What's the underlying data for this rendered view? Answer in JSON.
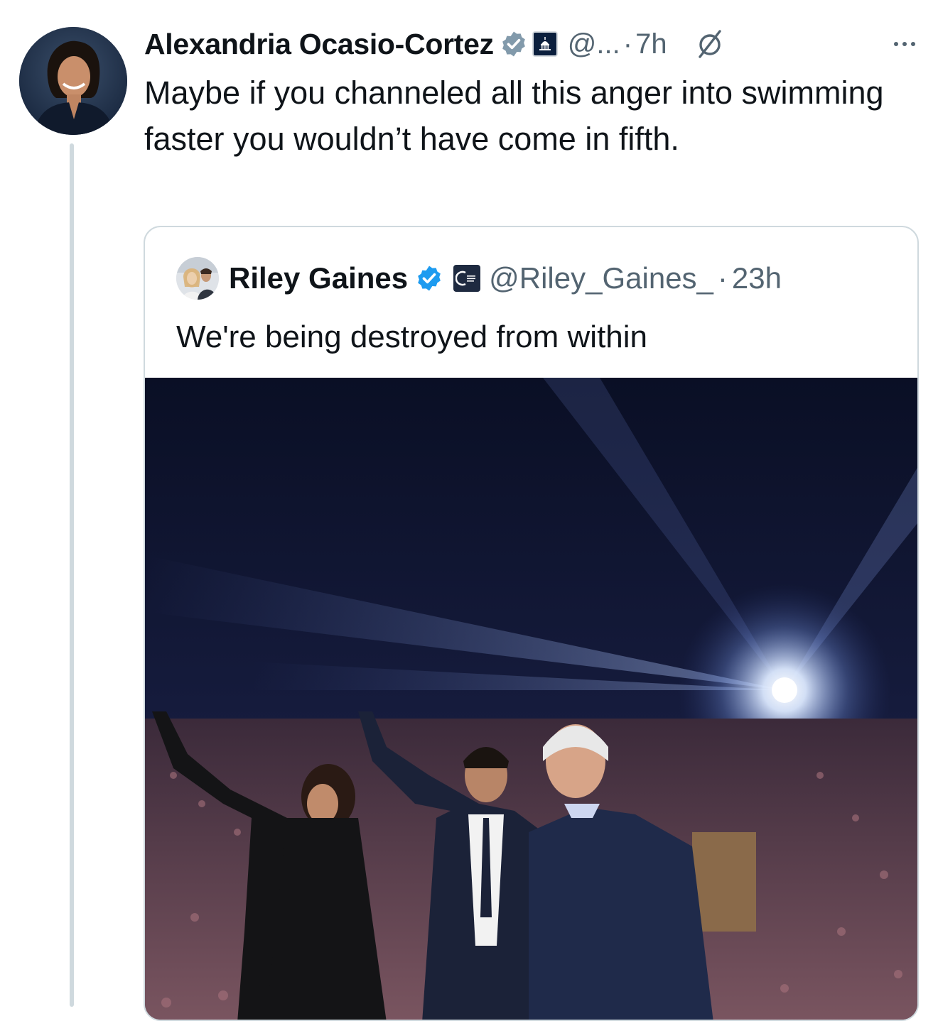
{
  "tweet": {
    "author": {
      "display_name": "Alexandria Ocasio-Cortez",
      "handle": "@...",
      "verified_badge": "gray-check",
      "affiliation_badge": "capitol-icon"
    },
    "separator": "·",
    "time": "7h",
    "text": "Maybe if you channeled all this anger into swimming faster you wouldn’t have come in fifth.",
    "icons": [
      "grok-icon",
      "more-icon"
    ]
  },
  "quote": {
    "author": {
      "display_name": "Riley Gaines",
      "handle": "@Riley_Gaines_",
      "verified_badge": "blue-check",
      "affiliation_badge": "turning-point-icon"
    },
    "separator": "·",
    "time": "23h",
    "text": "We're being destroyed from within"
  },
  "colors": {
    "text_primary": "#0f1419",
    "text_secondary": "#536471",
    "verified_blue": "#1d9bf0",
    "verified_gray": "#829aab",
    "border": "#cfd9de"
  }
}
